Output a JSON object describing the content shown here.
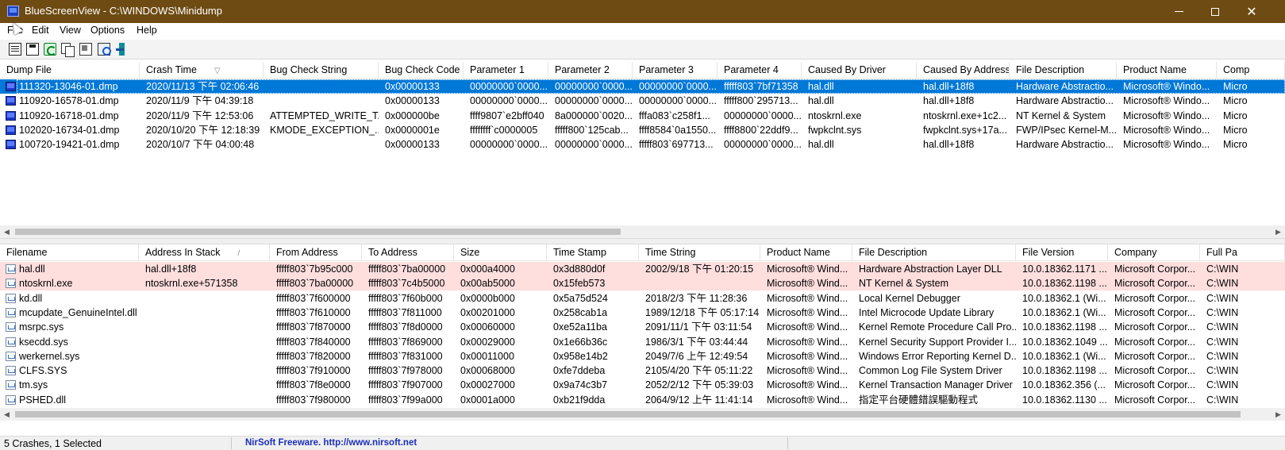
{
  "window": {
    "title": "BlueScreenView  -  C:\\WINDOWS\\Minidump",
    "controls": {
      "minimize": "minimize",
      "maximize": "maximize",
      "close": "✕"
    }
  },
  "menu": [
    "File",
    "Edit",
    "View",
    "Options",
    "Help"
  ],
  "toolbar": [
    "properties-icon",
    "save-icon",
    "refresh-icon",
    "copy-icon",
    "advanced-options-icon",
    "html-report-icon",
    "exit-icon"
  ],
  "crashes": {
    "columns": [
      "Dump File",
      "Crash Time",
      "Bug Check String",
      "Bug Check Code",
      "Parameter 1",
      "Parameter 2",
      "Parameter 3",
      "Parameter 4",
      "Caused By Driver",
      "Caused By Address",
      "File Description",
      "Product Name",
      "Comp"
    ],
    "sort_indicator": "▽",
    "rows": [
      [
        "111320-13046-01.dmp",
        "2020/11/13 下午 02:06:46",
        "",
        "0x00000133",
        "00000000`0000...",
        "00000000`0000...",
        "00000000`0000...",
        "fffff803`7bf71358",
        "hal.dll",
        "hal.dll+18f8",
        "Hardware Abstractio...",
        "Microsoft® Windo...",
        "Micro"
      ],
      [
        "110920-16578-01.dmp",
        "2020/11/9 下午 04:39:18",
        "",
        "0x00000133",
        "00000000`0000...",
        "00000000`0000...",
        "00000000`0000...",
        "fffff800`295713...",
        "hal.dll",
        "hal.dll+18f8",
        "Hardware Abstractio...",
        "Microsoft® Windo...",
        "Micro"
      ],
      [
        "110920-16718-01.dmp",
        "2020/11/9 下午 12:53:06",
        "ATTEMPTED_WRITE_T...",
        "0x000000be",
        "ffff9807`e2bff040",
        "8a000000`0020...",
        "fffa083`c258f1...",
        "00000000`0000...",
        "ntoskrnl.exe",
        "ntoskrnl.exe+1c2...",
        "NT Kernel & System",
        "Microsoft® Windo...",
        "Micro"
      ],
      [
        "102020-16734-01.dmp",
        "2020/10/20 下午 12:18:39",
        "KMODE_EXCEPTION_...",
        "0x0000001e",
        "ffffffff`c0000005",
        "fffff800`125cab...",
        "ffff8584`0a1550...",
        "ffff8800`22ddf9...",
        "fwpkclnt.sys",
        "fwpkclnt.sys+17a...",
        "FWP/IPsec Kernel-M...",
        "Microsoft® Windo...",
        "Micro"
      ],
      [
        "100720-19421-01.dmp",
        "2020/10/7 下午 04:00:48",
        "",
        "0x00000133",
        "00000000`0000...",
        "00000000`0000...",
        "fffff803`697713...",
        "00000000`0000...",
        "hal.dll",
        "hal.dll+18f8",
        "Hardware Abstractio...",
        "Microsoft® Windo...",
        "Micro"
      ]
    ],
    "selected_index": 0
  },
  "drivers": {
    "columns": [
      "Filename",
      "Address In Stack",
      "From Address",
      "To Address",
      "Size",
      "Time Stamp",
      "Time String",
      "Product Name",
      "File Description",
      "File Version",
      "Company",
      "Full Pa"
    ],
    "sort_indicator": "/",
    "rows": [
      [
        "hal.dll",
        "hal.dll+18f8",
        "fffff803`7b95c000",
        "fffff803`7ba00000",
        "0x000a4000",
        "0x3d880d0f",
        "2002/9/18 下午 01:20:15",
        "Microsoft® Wind...",
        "Hardware Abstraction Layer DLL",
        "10.0.18362.1171 ...",
        "Microsoft Corpor...",
        "C:\\WIN"
      ],
      [
        "ntoskrnl.exe",
        "ntoskrnl.exe+571358",
        "fffff803`7ba00000",
        "fffff803`7c4b5000",
        "0x00ab5000",
        "0x15feb573",
        "",
        "Microsoft® Wind...",
        "NT Kernel & System",
        "10.0.18362.1198 ...",
        "Microsoft Corpor...",
        "C:\\WIN"
      ],
      [
        "kd.dll",
        "",
        "fffff803`7f600000",
        "fffff803`7f60b000",
        "0x0000b000",
        "0x5a75d524",
        "2018/2/3 下午 11:28:36",
        "Microsoft® Wind...",
        "Local Kernel Debugger",
        "10.0.18362.1 (Wi...",
        "Microsoft Corpor...",
        "C:\\WIN"
      ],
      [
        "mcupdate_GenuineIntel.dll",
        "",
        "fffff803`7f610000",
        "fffff803`7f811000",
        "0x00201000",
        "0x258cab1a",
        "1989/12/18 下午 05:17:14",
        "Microsoft® Wind...",
        "Intel Microcode Update Library",
        "10.0.18362.1 (Wi...",
        "Microsoft Corpor...",
        "C:\\WIN"
      ],
      [
        "msrpc.sys",
        "",
        "fffff803`7f870000",
        "fffff803`7f8d0000",
        "0x00060000",
        "0xe52a11ba",
        "2091/11/1 下午 03:11:54",
        "Microsoft® Wind...",
        "Kernel Remote Procedure Call Pro...",
        "10.0.18362.1198 ...",
        "Microsoft Corpor...",
        "C:\\WIN"
      ],
      [
        "ksecdd.sys",
        "",
        "fffff803`7f840000",
        "fffff803`7f869000",
        "0x00029000",
        "0x1e66b36c",
        "1986/3/1 下午 03:44:44",
        "Microsoft® Wind...",
        "Kernel Security Support Provider I...",
        "10.0.18362.1049 ...",
        "Microsoft Corpor...",
        "C:\\WIN"
      ],
      [
        "werkernel.sys",
        "",
        "fffff803`7f820000",
        "fffff803`7f831000",
        "0x00011000",
        "0x958e14b2",
        "2049/7/6 上午 12:49:54",
        "Microsoft® Wind...",
        "Windows Error Reporting Kernel D...",
        "10.0.18362.1 (Wi...",
        "Microsoft Corpor...",
        "C:\\WIN"
      ],
      [
        "CLFS.SYS",
        "",
        "fffff803`7f910000",
        "fffff803`7f978000",
        "0x00068000",
        "0xfe7ddeba",
        "2105/4/20 下午 05:11:22",
        "Microsoft® Wind...",
        "Common Log File System Driver",
        "10.0.18362.1198 ...",
        "Microsoft Corpor...",
        "C:\\WIN"
      ],
      [
        "tm.sys",
        "",
        "fffff803`7f8e0000",
        "fffff803`7f907000",
        "0x00027000",
        "0x9a74c3b7",
        "2052/2/12 下午 05:39:03",
        "Microsoft® Wind...",
        "Kernel Transaction Manager Driver",
        "10.0.18362.356 (...",
        "Microsoft Corpor...",
        "C:\\WIN"
      ],
      [
        "PSHED.dll",
        "",
        "fffff803`7f980000",
        "fffff803`7f99a000",
        "0x0001a000",
        "0xb21f9dda",
        "2064/9/12 上午 11:41:14",
        "Microsoft® Wind...",
        "指定平台硬體錯誤驅動程式",
        "10.0.18362.1130 ...",
        "Microsoft Corpor...",
        "C:\\WIN"
      ]
    ],
    "highlighted_indices": [
      0,
      1
    ]
  },
  "status": {
    "summary": "5 Crashes, 1 Selected",
    "credit": "NirSoft Freeware.  http://www.nirsoft.net"
  },
  "colors": {
    "titlebar": "#6e4b13",
    "selection": "#0078d7",
    "highlight_row": "#ffdede",
    "credit_text": "#1a2fb8"
  }
}
